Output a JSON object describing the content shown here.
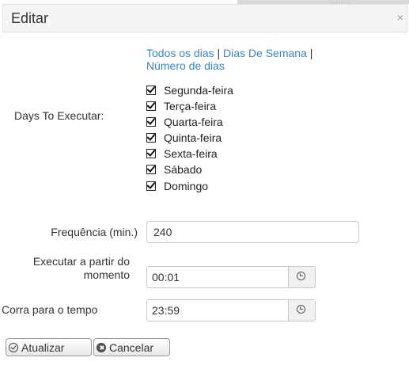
{
  "dialog": {
    "title": "Editar",
    "close_glyph": "×",
    "background_text": "........"
  },
  "days": {
    "label": "Days To Executar:",
    "links": {
      "all_days": "Todos os dias",
      "separator1": " | ",
      "weekdays": "Dias De Semana",
      "separator2": " |",
      "count": "Número de dias"
    },
    "items": [
      {
        "label": "Segunda-feira",
        "checked": true
      },
      {
        "label": "Terça-feira",
        "checked": true
      },
      {
        "label": "Quarta-feira",
        "checked": true
      },
      {
        "label": "Quinta-feira",
        "checked": true
      },
      {
        "label": "Sexta-feira",
        "checked": true
      },
      {
        "label": "Sábado",
        "checked": true
      },
      {
        "label": "Domingo",
        "checked": true
      }
    ]
  },
  "frequency": {
    "label": "Frequência (min.)",
    "value": "240"
  },
  "start_time": {
    "label_line1": "Executar a partir do",
    "label_line2": "momento",
    "value": "00:01",
    "icon": "clock-icon"
  },
  "end_time": {
    "label": "Corra para o tempo",
    "value": "23:59",
    "icon": "clock-icon"
  },
  "buttons": {
    "update": "Atualizar",
    "cancel": "Cancelar"
  },
  "colors": {
    "link": "#3a85c6",
    "title_bar": "#f5f5f5"
  }
}
